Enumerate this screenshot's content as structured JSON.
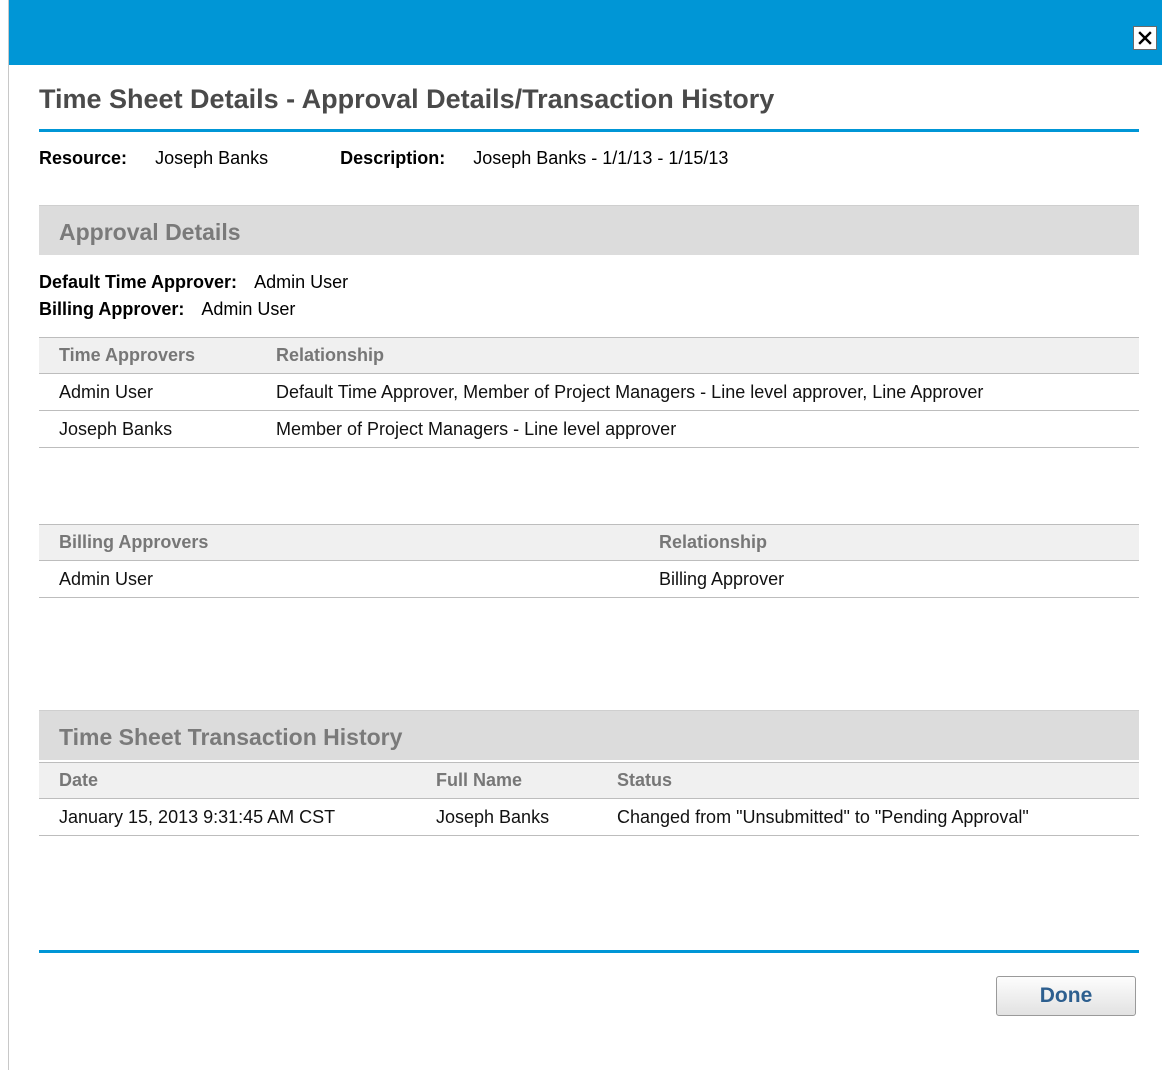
{
  "dialog": {
    "title": "Time Sheet Details - Approval Details/Transaction History",
    "close_icon": "close-x-icon"
  },
  "meta": {
    "resource_label": "Resource:",
    "resource_value": "Joseph Banks",
    "description_label": "Description:",
    "description_value": "Joseph Banks - 1/1/13 - 1/15/13"
  },
  "approval": {
    "header": "Approval Details",
    "default_label": "Default Time Approver:",
    "default_value": "Admin User",
    "billing_label": "Billing Approver:",
    "billing_value": "Admin User"
  },
  "time_approvers": {
    "columns": [
      "Time Approvers",
      "Relationship"
    ],
    "rows": [
      [
        "Admin User",
        "Default Time Approver, Member of Project Managers - Line level approver, Line Approver"
      ],
      [
        "Joseph Banks",
        "Member of Project Managers - Line level approver"
      ]
    ]
  },
  "billing_approvers": {
    "columns": [
      "Billing Approvers",
      "Relationship"
    ],
    "rows": [
      [
        "Admin User",
        "Billing Approver"
      ]
    ]
  },
  "history": {
    "header": "Time Sheet Transaction History",
    "columns": [
      "Date",
      "Full Name",
      "Status"
    ],
    "rows": [
      [
        "January 15, 2013 9:31:45 AM CST",
        "Joseph Banks",
        "Changed from \"Unsubmitted\" to \"Pending Approval\""
      ]
    ]
  },
  "footer": {
    "done_label": "Done"
  }
}
